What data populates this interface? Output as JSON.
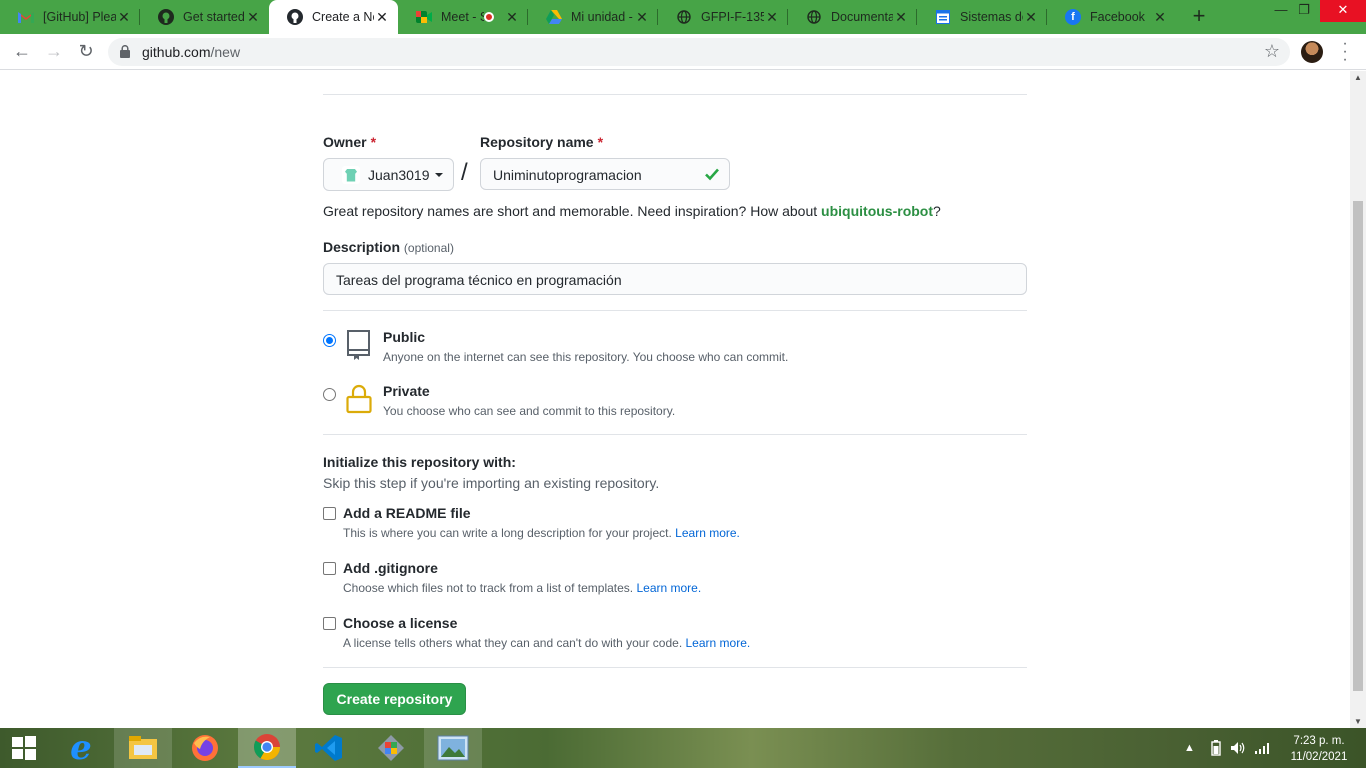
{
  "browser": {
    "tabs": [
      {
        "title": "[GitHub] Please",
        "icon": "gmail-icon"
      },
      {
        "title": "Get started",
        "icon": "github-icon"
      },
      {
        "title": "Create a New Repository",
        "icon": "github-icon",
        "active": true
      },
      {
        "title": "Meet - S",
        "icon": "meet-icon"
      },
      {
        "title": "Mi unidad -",
        "icon": "drive-icon"
      },
      {
        "title": "GFPI-F-135",
        "icon": "globe-icon"
      },
      {
        "title": "Documentat",
        "icon": "globe-icon"
      },
      {
        "title": "Sistemas de",
        "icon": "forms-icon"
      },
      {
        "title": "Facebook",
        "icon": "facebook-icon"
      }
    ],
    "url_host": "github.com",
    "url_path": "/new"
  },
  "form": {
    "owner_label": "Owner",
    "required_mark": "*",
    "owner_value": "Juan3019",
    "repo_label": "Repository name",
    "repo_value": "Uniminutoprogramacion",
    "hint_text": "Great repository names are short and memorable. Need inspiration? How about",
    "hint_suggestion": "ubiquitous-robot",
    "hint_end": "?",
    "description_label": "Description",
    "description_optional": "(optional)",
    "description_value": "Tareas del programa técnico en programación",
    "visibility": [
      {
        "title": "Public",
        "subtitle": "Anyone on the internet can see this repository. You choose who can commit.",
        "selected": true
      },
      {
        "title": "Private",
        "subtitle": "You choose who can see and commit to this repository.",
        "selected": false
      }
    ],
    "init_title": "Initialize this repository with:",
    "init_subtitle": "Skip this step if you're importing an existing repository.",
    "init_options": [
      {
        "title": "Add a README file",
        "subtitle": "This is where you can write a long description for your project.",
        "link": "Learn more.",
        "checked": false
      },
      {
        "title": "Add .gitignore",
        "subtitle": "Choose which files not to track from a list of templates.",
        "link": "Learn more.",
        "checked": false
      },
      {
        "title": "Choose a license",
        "subtitle": "A license tells others what they can and can't do with your code.",
        "link": "Learn more.",
        "checked": false
      }
    ],
    "submit_label": "Create repository"
  },
  "taskbar": {
    "time": "7:23 p. m.",
    "date": "11/02/2021",
    "apps": [
      "start-icon",
      "edge-icon",
      "file-explorer-icon",
      "firefox-icon",
      "chrome-icon",
      "vscode-icon",
      "app-icon",
      "photos-icon"
    ]
  },
  "colors": {
    "tab_strip": "#47a447",
    "primary_button": "#2ea44f",
    "link": "#0366d6",
    "suggestion": "#2c8f43",
    "required": "#cb2431"
  }
}
